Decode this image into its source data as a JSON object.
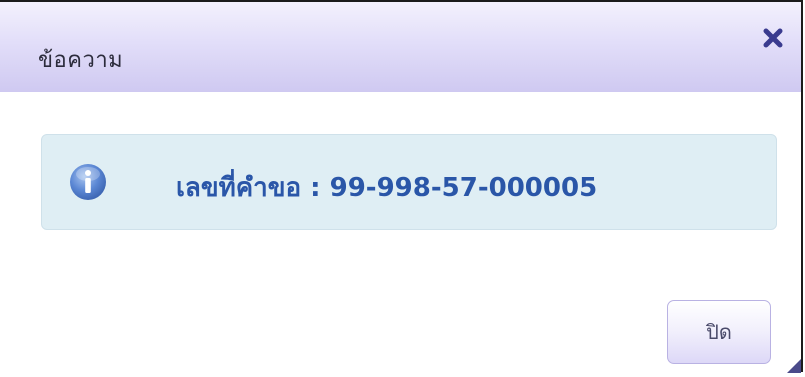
{
  "dialog": {
    "title": "ข้อความ",
    "close_icon": "close-x-icon",
    "message": "เลขที่คำขอ : 99-998-57-000005",
    "info_icon": "info-icon",
    "close_button_label": "ปิด"
  },
  "colors": {
    "title_bar_start": "#f3f1fd",
    "title_bar_end": "#cfc9f1",
    "info_box_bg": "#dfeef4",
    "message_text": "#2a56a8",
    "close_icon": "#3a3b8f"
  }
}
